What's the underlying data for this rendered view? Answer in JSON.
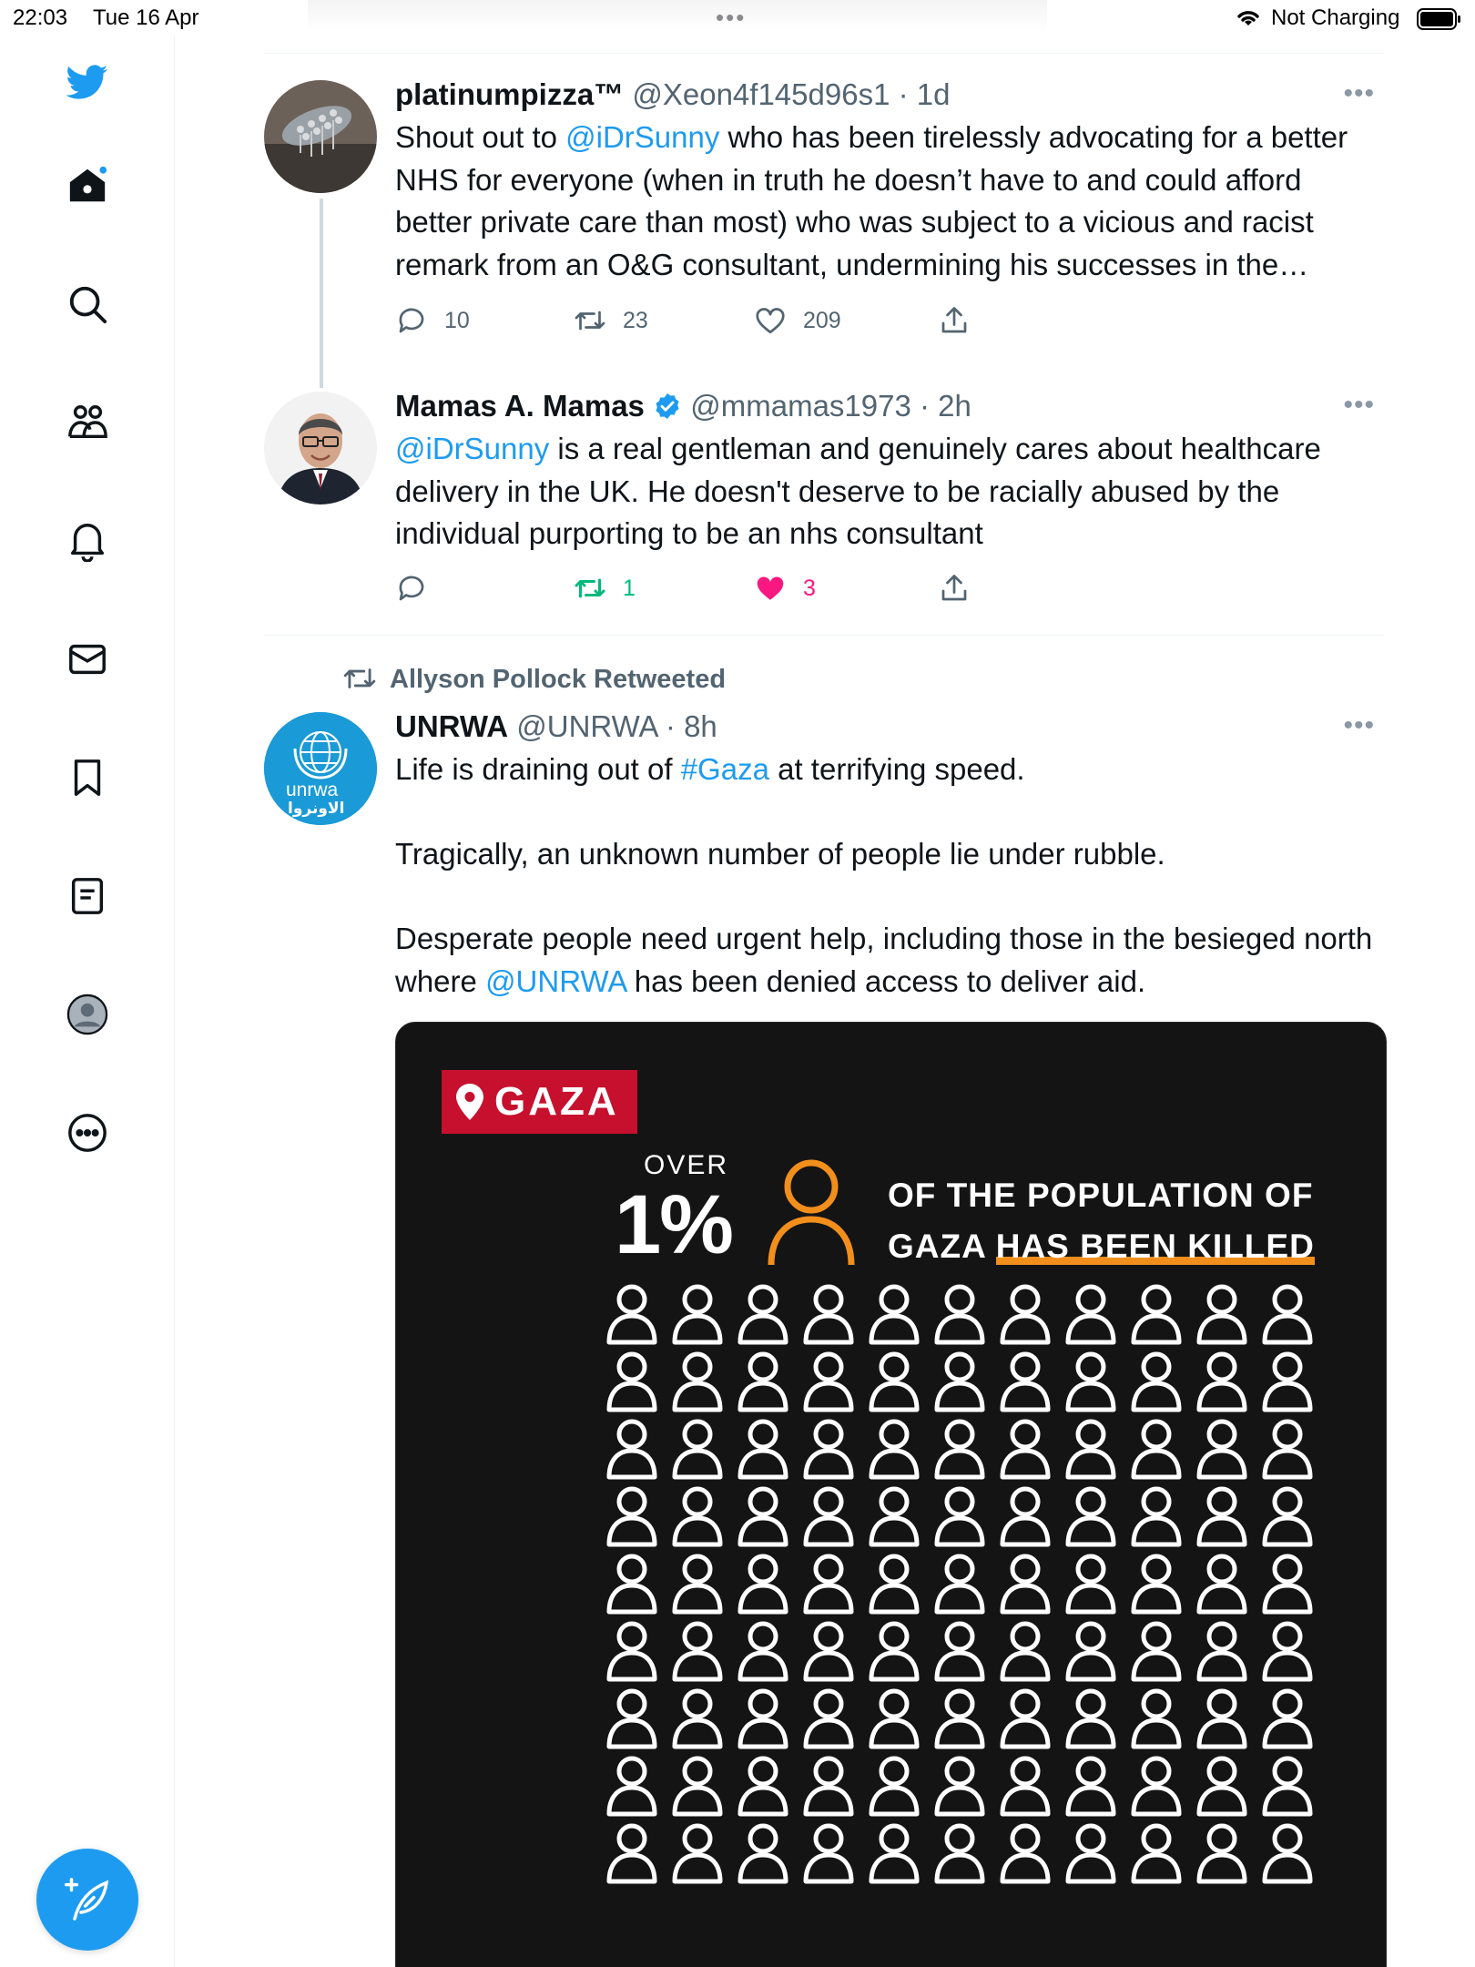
{
  "status_bar": {
    "time": "22:03",
    "date": "Tue 16 Apr",
    "dots": "•••",
    "charging": "Not Charging"
  },
  "sidebar": {
    "items": [
      "bird-logo",
      "home",
      "explore",
      "communities",
      "notifications",
      "messages",
      "bookmarks",
      "lists",
      "profile",
      "more"
    ],
    "compose_icon": "compose-icon"
  },
  "tweets": [
    {
      "name": "platinumpizza™",
      "meta": "@Xeon4f145d96s1 · 1d",
      "more": "•••",
      "body_parts": [
        {
          "text": "Shout out to ",
          "link": false
        },
        {
          "text": "@iDrSunny",
          "link": true
        },
        {
          "text": " who has been tirelessly advocating for a better NHS for everyone (when in truth he doesn’t have to and could afford better private care than most) who was subject to a vicious and racist remark from an O&G consultant, undermining his successes in the…",
          "link": false
        }
      ],
      "replies": "10",
      "retweets": "23",
      "likes": "209"
    },
    {
      "name": "Mamas A. Mamas",
      "verified": true,
      "meta": "@mmamas1973 · 2h",
      "more": "•••",
      "body_parts": [
        {
          "text": "@iDrSunny",
          "link": true
        },
        {
          "text": " is a real gentleman and genuinely cares about healthcare delivery in the UK. He doesn't deserve to be racially abused by the individual purporting to be an nhs consultant",
          "link": false
        }
      ],
      "replies": "",
      "retweets": "1",
      "likes": "3",
      "retweeted": true,
      "liked": true
    },
    {
      "retweeted_by": "Allyson Pollock Retweeted",
      "name": "UNRWA",
      "meta": "@UNRWA · 8h",
      "more": "•••",
      "avatar_text": {
        "latin": "unrwa",
        "arabic": "الاونروا"
      },
      "para1_parts": [
        {
          "text": "Life is draining out of ",
          "link": false
        },
        {
          "text": "#Gaza",
          "link": true
        },
        {
          "text": " at terrifying speed.",
          "link": false
        }
      ],
      "para2": "Tragically, an unknown number of people lie under rubble.",
      "para3_parts": [
        {
          "text": "Desperate people need urgent help, including those in the besieged north where ",
          "link": false
        },
        {
          "text": "@UNRWA",
          "link": true
        },
        {
          "text": " has been denied access to deliver aid.",
          "link": false
        }
      ],
      "media": {
        "tag": "GAZA",
        "over": "OVER",
        "percent": "1%",
        "headline_line1": "OF THE POPULATION OF",
        "headline_line2_plain": "GAZA ",
        "headline_line2_highlight": "HAS BEEN KILLED",
        "grid_columns": 11,
        "grid_rows": 9,
        "colors": {
          "tag": "#c7102e",
          "accent": "#f28e1c",
          "background": "#141414"
        }
      }
    }
  ],
  "colors": {
    "brand": "#1d9bf0",
    "retweet": "#00ba7c",
    "like": "#f91880",
    "muted": "#536471"
  }
}
